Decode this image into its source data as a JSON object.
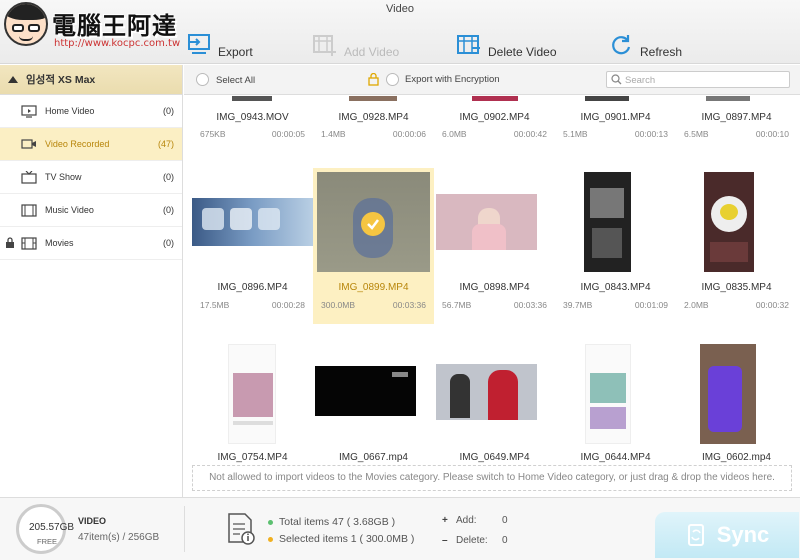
{
  "window": {
    "title": "Video"
  },
  "logo": {
    "name": "電腦王阿達",
    "url": "http://www.kocpc.com.tw"
  },
  "toolbar": {
    "export": "Export",
    "add_video": "Add Video",
    "delete_video": "Delete Video",
    "refresh": "Refresh"
  },
  "sidebar": {
    "device": "임성적 XS Max",
    "items": [
      {
        "label": "Home Video",
        "count": "(0)",
        "icon": "monitor-icon"
      },
      {
        "label": "Video Recorded",
        "count": "(47)",
        "icon": "camera-icon"
      },
      {
        "label": "TV Show",
        "count": "(0)",
        "icon": "tv-icon"
      },
      {
        "label": "Music Video",
        "count": "(0)",
        "icon": "music-video-icon"
      },
      {
        "label": "Movies",
        "count": "(0)",
        "icon": "film-icon"
      }
    ]
  },
  "filter": {
    "select_all": "Select All",
    "export_encryption": "Export with Encryption",
    "search_placeholder": "Search"
  },
  "videos": [
    {
      "name": "IMG_0943.MOV",
      "size": "675KB",
      "duration": "00:00:05"
    },
    {
      "name": "IMG_0928.MP4",
      "size": "1.4MB",
      "duration": "00:00:06"
    },
    {
      "name": "IMG_0902.MP4",
      "size": "6.0MB",
      "duration": "00:00:42"
    },
    {
      "name": "IMG_0901.MP4",
      "size": "5.1MB",
      "duration": "00:00:13"
    },
    {
      "name": "IMG_0897.MP4",
      "size": "6.5MB",
      "duration": "00:00:10"
    },
    {
      "name": "IMG_0896.MP4",
      "size": "17.5MB",
      "duration": "00:00:28"
    },
    {
      "name": "IMG_0899.MP4",
      "size": "300.0MB",
      "duration": "00:03:36",
      "selected": true
    },
    {
      "name": "IMG_0898.MP4",
      "size": "56.7MB",
      "duration": "00:03:36"
    },
    {
      "name": "IMG_0843.MP4",
      "size": "39.7MB",
      "duration": "00:01:09"
    },
    {
      "name": "IMG_0835.MP4",
      "size": "2.0MB",
      "duration": "00:00:32"
    },
    {
      "name": "IMG_0754.MP4",
      "size": "",
      "duration": ""
    },
    {
      "name": "IMG_0667.mp4",
      "size": "",
      "duration": ""
    },
    {
      "name": "IMG_0649.MP4",
      "size": "",
      "duration": ""
    },
    {
      "name": "IMG_0644.MP4",
      "size": "",
      "duration": ""
    },
    {
      "name": "IMG_0602.mp4",
      "size": "",
      "duration": ""
    }
  ],
  "notice": "Not allowed to  import videos to the Movies category. Please switch to Home Video category, or just drag & drop the videos here.",
  "bottom": {
    "free_value": "205.57GB",
    "free_label": "FREE",
    "section": "VIDEO",
    "capacity": "47item(s) / 256GB",
    "total": "Total items 47 ( 3.68GB )",
    "selected": "Selected items 1 ( 300.0MB )",
    "add_label": "Add:",
    "add_value": "0",
    "delete_label": "Delete:",
    "delete_value": "0",
    "sync": "Sync"
  },
  "colors": {
    "accent": "#f5c542",
    "selected_bg": "#fdf0c2",
    "sync_bg": "#c2e9f5",
    "icon_blue": "#2b8fd6"
  }
}
